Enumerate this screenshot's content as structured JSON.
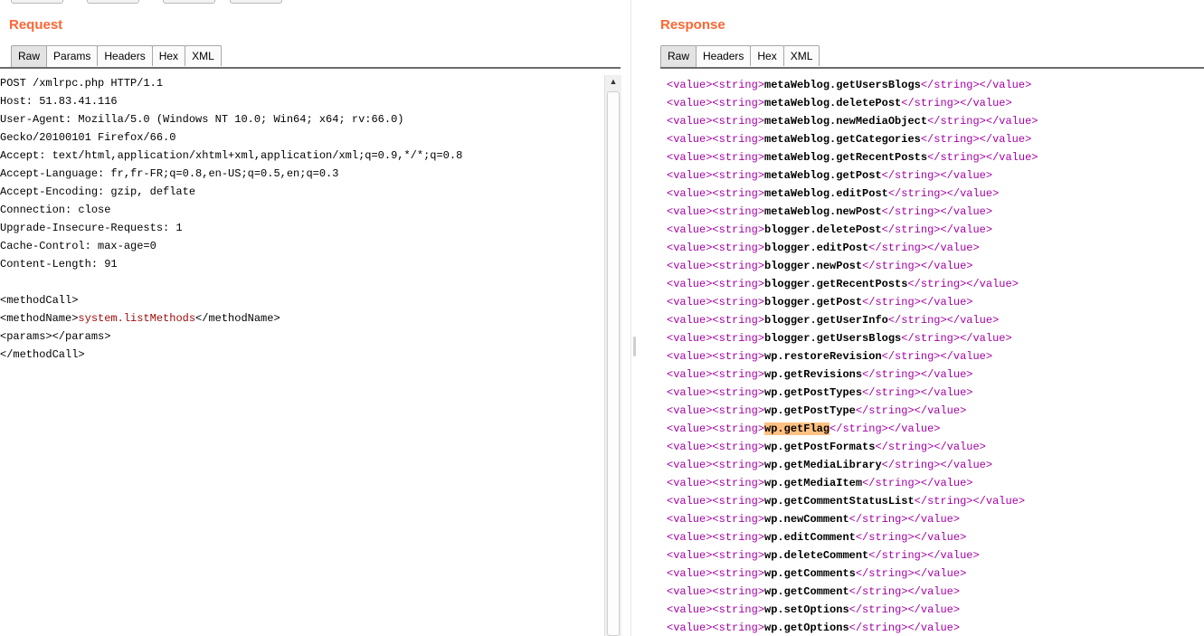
{
  "request": {
    "title": "Request",
    "tabs": [
      "Raw",
      "Params",
      "Headers",
      "Hex",
      "XML"
    ],
    "active_tab": "Raw",
    "lines": [
      "POST /xmlrpc.php HTTP/1.1",
      "Host: 51.83.41.116",
      "User-Agent: Mozilla/5.0 (Windows NT 10.0; Win64; x64; rv:66.0)",
      "Gecko/20100101 Firefox/66.0",
      "Accept: text/html,application/xhtml+xml,application/xml;q=0.9,*/*;q=0.8",
      "Accept-Language: fr,fr-FR;q=0.8,en-US;q=0.5,en;q=0.3",
      "Accept-Encoding: gzip, deflate",
      "Connection: close",
      "Upgrade-Insecure-Requests: 1",
      "Cache-Control: max-age=0",
      "Content-Length: 91",
      ""
    ],
    "body": {
      "open_call": "<methodCall>",
      "method_open": "<methodName>",
      "method_name": "system.listMethods",
      "method_close": "</methodName>",
      "params": "<params></params>",
      "close_call": "</methodCall>"
    }
  },
  "response": {
    "title": "Response",
    "tabs": [
      "Raw",
      "Headers",
      "Hex",
      "XML"
    ],
    "active_tab": "Raw",
    "value_open": "<value>",
    "string_open": "<string>",
    "string_close": "</string>",
    "value_close": "</value>",
    "highlighted": "wp.getFlag",
    "methods": [
      "metaWeblog.getUsersBlogs",
      "metaWeblog.deletePost",
      "metaWeblog.newMediaObject",
      "metaWeblog.getCategories",
      "metaWeblog.getRecentPosts",
      "metaWeblog.getPost",
      "metaWeblog.editPost",
      "metaWeblog.newPost",
      "blogger.deletePost",
      "blogger.editPost",
      "blogger.newPost",
      "blogger.getRecentPosts",
      "blogger.getPost",
      "blogger.getUserInfo",
      "blogger.getUsersBlogs",
      "wp.restoreRevision",
      "wp.getRevisions",
      "wp.getPostTypes",
      "wp.getPostType",
      "wp.getFlag",
      "wp.getPostFormats",
      "wp.getMediaLibrary",
      "wp.getMediaItem",
      "wp.getCommentStatusList",
      "wp.newComment",
      "wp.editComment",
      "wp.deleteComment",
      "wp.getComments",
      "wp.getComment",
      "wp.setOptions",
      "wp.getOptions"
    ]
  },
  "colors": {
    "title": "#ff6633",
    "xml_tag_response": "#a500a5",
    "method_name_request": "#a10b0b",
    "highlight": "#ffc080"
  },
  "icons": {
    "scroll_up": "▲"
  }
}
